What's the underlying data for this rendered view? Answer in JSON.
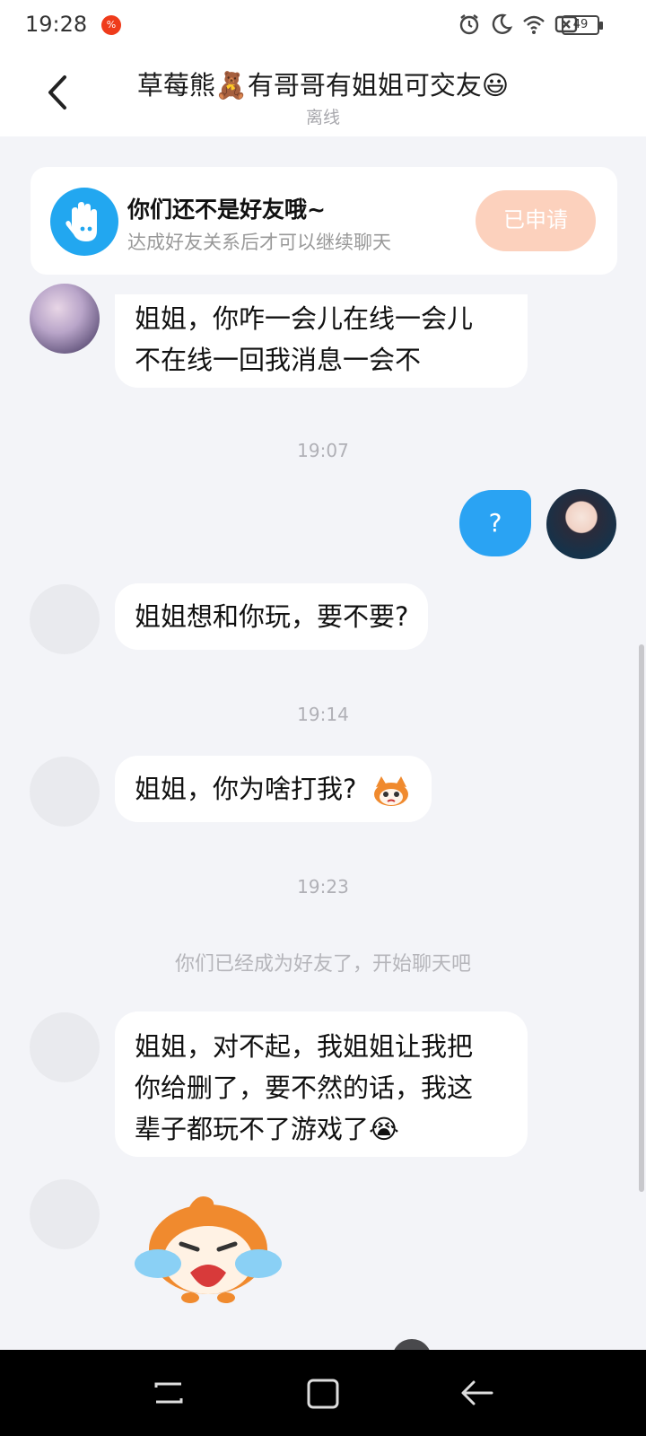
{
  "status_bar": {
    "time": "19:28",
    "app_badge": "%",
    "battery": "49"
  },
  "header": {
    "title": "草莓熊🧸有哥哥有姐姐可交友😃",
    "status": "离线"
  },
  "notice": {
    "title": "你们还不是好友哦~",
    "subtitle": "达成好友关系后才可以继续聊天",
    "button_label": "已申请"
  },
  "messages": {
    "m1_line1": "姐姐，你咋一会儿在线一会儿",
    "m1_line2": "不在线一回我消息一会不",
    "t1": "19:07",
    "self_msg": "?",
    "m2": "姐姐想和你玩，要不要?",
    "t2": "19:14",
    "m3": "姐姐，你为啥打我?",
    "t3": "19:23",
    "system": "你们已经成为好友了，开始聊天吧",
    "m4_line1": "姐姐，对不起，我姐姐让我把",
    "m4_line2": "你给删了，要不然的话，我这",
    "m4_line3": "辈子都玩不了游戏了😭"
  },
  "colors": {
    "accent_blue": "#2aa3f3",
    "apply_button": "#fcd1bd",
    "background": "#f3f4f8"
  }
}
